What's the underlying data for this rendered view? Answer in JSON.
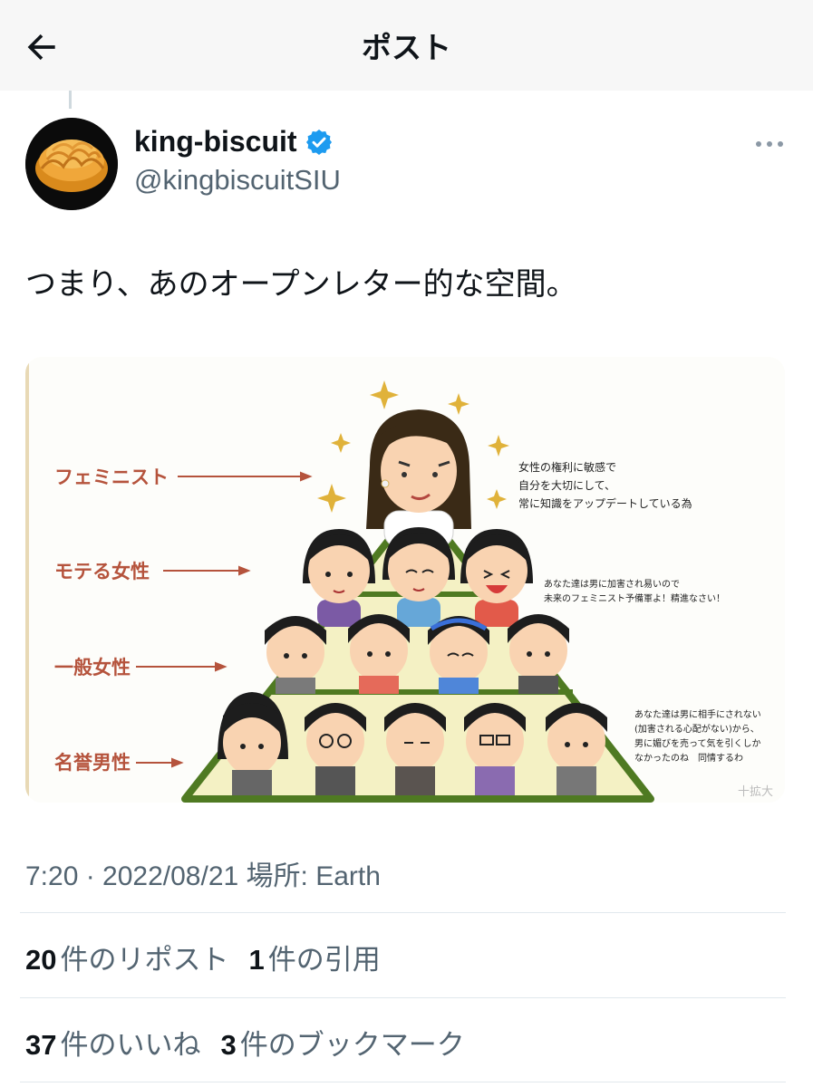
{
  "header": {
    "title": "ポスト"
  },
  "author": {
    "display_name": "king-biscuit",
    "handle": "@kingbiscuitSIU",
    "verified": true
  },
  "post": {
    "text": "つまり、あのオープンレター的な空間。",
    "meta": "7:20 · 2022/08/21 場所: Earth"
  },
  "image": {
    "labels": [
      "フェミニスト",
      "モテる女性",
      "一般女性",
      "名誉男性"
    ],
    "note_top": [
      "女性の権利に敏感で",
      "自分を大切にして、",
      "常に知識をアップデートしている為"
    ],
    "note_mid": [
      "あなた達は男に加害され易いので",
      "未来のフェミニスト予備軍よ！精進なさい！"
    ],
    "note_bottom": [
      "あなた達は男に相手にされない",
      "(加害される心配がない)から、",
      "男に媚びを売って気を引くしか",
      "なかったのね　同情するわ"
    ],
    "watermark": "十拡大"
  },
  "stats": {
    "reposts": {
      "count": "20",
      "label": "件のリポスト"
    },
    "quotes": {
      "count": "1",
      "label": "件の引用"
    },
    "likes": {
      "count": "37",
      "label": "件のいいね"
    },
    "bookmarks": {
      "count": "3",
      "label": "件のブックマーク"
    }
  },
  "colors": {
    "verified": "#1d9bf0",
    "muted": "#536471",
    "label_red": "#b5533c",
    "pyramid_green": "#4f7a22"
  },
  "icons": [
    "back-arrow-icon",
    "verified-badge-icon",
    "more-icon"
  ]
}
